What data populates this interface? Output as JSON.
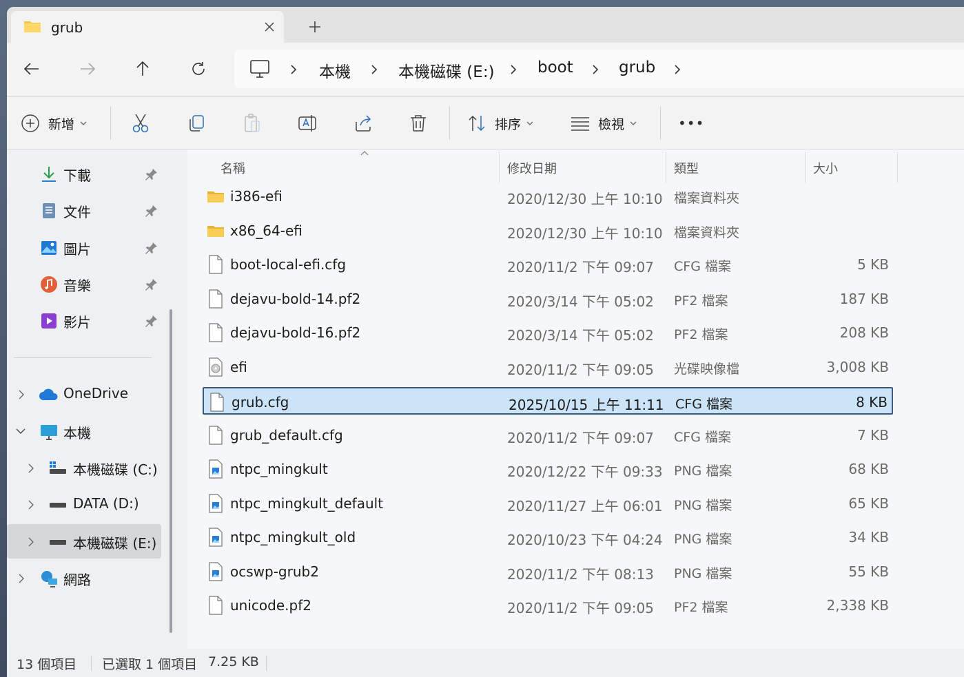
{
  "window": {
    "tab_title": "grub",
    "tab_close_icon": "close-icon",
    "new_tab_icon": "plus-icon"
  },
  "nav": {
    "back_icon": "arrow-left-icon",
    "forward_icon": "arrow-right-icon",
    "up_icon": "arrow-up-icon",
    "refresh_icon": "refresh-icon"
  },
  "breadcrumb": [
    "本機",
    "本機磁碟 (E:)",
    "boot",
    "grub"
  ],
  "toolbar": {
    "new_label": "新增",
    "sort_label": "排序",
    "view_label": "檢視",
    "more_label": "•••"
  },
  "sidebar": {
    "quick_access": [
      {
        "label": "下載",
        "icon": "download-icon"
      },
      {
        "label": "文件",
        "icon": "document-icon"
      },
      {
        "label": "圖片",
        "icon": "pictures-icon"
      },
      {
        "label": "音樂",
        "icon": "music-icon"
      },
      {
        "label": "影片",
        "icon": "video-icon"
      }
    ],
    "tree": [
      {
        "label": "OneDrive",
        "icon": "cloud-icon"
      },
      {
        "label": "本機",
        "icon": "computer-icon"
      },
      {
        "label": "本機磁碟 (C:)",
        "icon": "windows-drive-icon"
      },
      {
        "label": "DATA (D:)",
        "icon": "drive-icon"
      },
      {
        "label": "本機磁碟 (E:)",
        "icon": "drive-icon"
      },
      {
        "label": "網路",
        "icon": "network-icon"
      }
    ]
  },
  "columns": {
    "name": "名稱",
    "date": "修改日期",
    "type": "類型",
    "size": "大小"
  },
  "files": [
    {
      "name": "i386-efi",
      "date": "2020/12/30 上午 10:10",
      "type": "檔案資料夾",
      "size": "",
      "icon": "folder-icon"
    },
    {
      "name": "x86_64-efi",
      "date": "2020/12/30 上午 10:10",
      "type": "檔案資料夾",
      "size": "",
      "icon": "folder-icon"
    },
    {
      "name": "boot-local-efi.cfg",
      "date": "2020/11/2 下午 09:07",
      "type": "CFG 檔案",
      "size": "5 KB",
      "icon": "file-icon"
    },
    {
      "name": "dejavu-bold-14.pf2",
      "date": "2020/3/14 下午 05:02",
      "type": "PF2 檔案",
      "size": "187 KB",
      "icon": "file-icon"
    },
    {
      "name": "dejavu-bold-16.pf2",
      "date": "2020/3/14 下午 05:02",
      "type": "PF2 檔案",
      "size": "208 KB",
      "icon": "file-icon"
    },
    {
      "name": "efi",
      "date": "2020/11/2 下午 09:05",
      "type": "光碟映像檔",
      "size": "3,008 KB",
      "icon": "disc-image-icon"
    },
    {
      "name": "grub.cfg",
      "date": "2025/10/15 上午 11:11",
      "type": "CFG 檔案",
      "size": "8 KB",
      "icon": "file-icon"
    },
    {
      "name": "grub_default.cfg",
      "date": "2020/11/2 下午 09:07",
      "type": "CFG 檔案",
      "size": "7 KB",
      "icon": "file-icon"
    },
    {
      "name": "ntpc_mingkult",
      "date": "2020/12/22 下午 09:33",
      "type": "PNG 檔案",
      "size": "68 KB",
      "icon": "image-file-icon"
    },
    {
      "name": "ntpc_mingkult_default",
      "date": "2020/11/27 上午 06:01",
      "type": "PNG 檔案",
      "size": "65 KB",
      "icon": "image-file-icon"
    },
    {
      "name": "ntpc_mingkult_old",
      "date": "2020/10/23 下午 04:24",
      "type": "PNG 檔案",
      "size": "34 KB",
      "icon": "image-file-icon"
    },
    {
      "name": "ocswp-grub2",
      "date": "2020/11/2 下午 08:13",
      "type": "PNG 檔案",
      "size": "55 KB",
      "icon": "image-file-icon"
    },
    {
      "name": "unicode.pf2",
      "date": "2020/11/2 下午 09:05",
      "type": "PF2 檔案",
      "size": "2,338 KB",
      "icon": "file-icon"
    }
  ],
  "selected_index": 6,
  "status": {
    "count": "13 個項目",
    "selection": "已選取 1 個項目",
    "selection_size": "7.25 KB"
  },
  "colors": {
    "selection_bg": "#cce4f7",
    "selection_border": "#3b5b7e",
    "folder": "#f4c542"
  }
}
